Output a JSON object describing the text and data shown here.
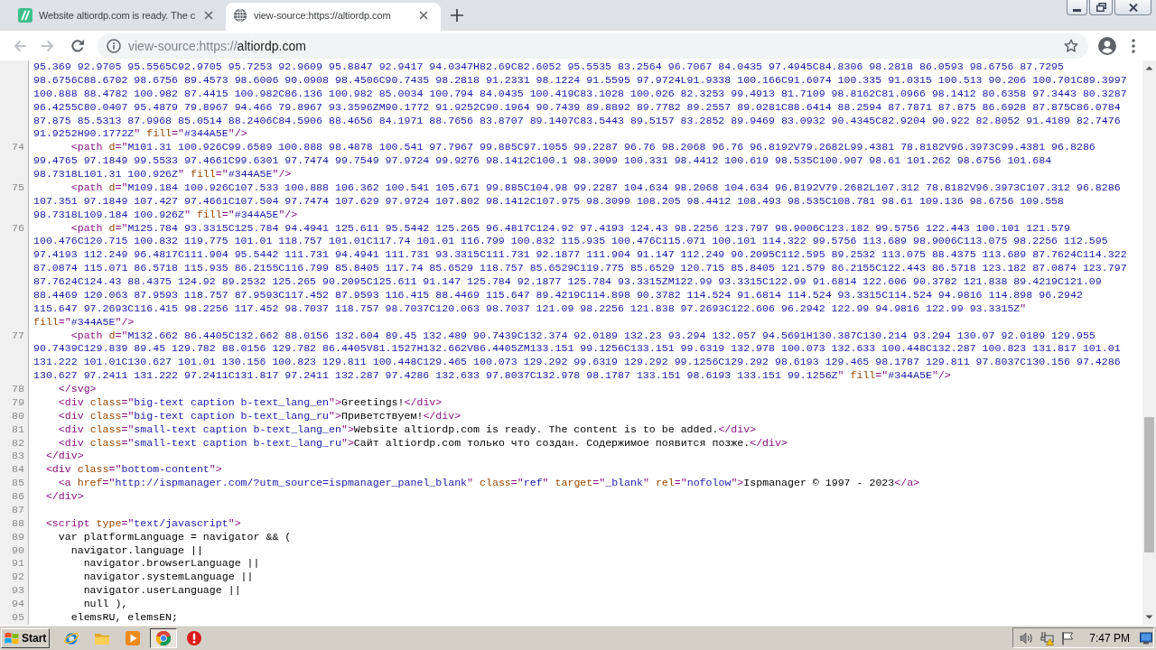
{
  "tabs": [
    {
      "title": "Website altiordp.com is ready. The c",
      "selected": false
    },
    {
      "title": "view-source:https://altiordp.com",
      "selected": true
    }
  ],
  "address_bar": {
    "prefix": "view-source:https://",
    "host": "altiordp.com"
  },
  "source_view": {
    "lines": [
      {
        "segments": [
          {
            "tokens": [
              {
                "kind": "value",
                "text": "95.369 92.9705 95.5565C92.9705 95.7253 92.9609 95.8847 92.9417 94.0347H82.69C82.6052 95.5535 83.2564 96.7067 84.0435 97.4945C84.8306 98.2818 86.0593 98.6756 87.7295"
              }
            ]
          },
          {
            "tokens": [
              {
                "kind": "value",
                "text": "98.6756C88.6702 98.6756 89.4573 98.6006 90.0908 98.4506C90.7435 98.2818 91.2331 98.1224 91.5595 97.9724L91.9338 100.166C91.6074 100.335 91.0315 100.513 90.206 100.701C89.3997"
              }
            ]
          },
          {
            "tokens": [
              {
                "kind": "value",
                "text": "100.888 88.4782 100.982 87.4415 100.982C86.136 100.982 85.0034 100.794 84.0435 100.419C83.1028 100.026 82.3253 99.4913 81.7109 98.8162C81.0966 98.1412 80.6358 97.3443 80.3287"
              }
            ]
          },
          {
            "tokens": [
              {
                "kind": "value",
                "text": "96.4255C80.0407 95.4879 79.8967 94.466 79.8967 93.3596ZM90.1772 91.9252C90.1964 90.7439 89.8892 89.7782 89.2557 89.0281C88.6414 88.2594 87.7871 87.875 86.6928 87.875C86.0784"
              }
            ]
          },
          {
            "tokens": [
              {
                "kind": "value",
                "text": "87.875 85.5313 87.9968 85.0514 88.2406C84.5906 88.4656 84.1971 88.7656 83.8707 89.1407C83.5443 89.5157 83.2852 89.9469 83.0932 90.4345C82.9204 90.922 82.8052 91.4189 82.7476"
              }
            ]
          },
          {
            "tokens": [
              {
                "kind": "value",
                "text": "91.9252H90.1772Z"
              },
              {
                "kind": "tag",
                "text": "\" "
              },
              {
                "kind": "attr",
                "text": "fill"
              },
              {
                "kind": "tag",
                "text": "=\""
              },
              {
                "kind": "value",
                "text": "#344A5E"
              },
              {
                "kind": "tag",
                "text": "\"/>"
              }
            ]
          }
        ]
      },
      {
        "number": "74",
        "segments": [
          {
            "tokens": [
              {
                "kind": "tag",
                "text": "      <path "
              },
              {
                "kind": "attr",
                "text": "d"
              },
              {
                "kind": "tag",
                "text": "=\""
              },
              {
                "kind": "value",
                "text": "M101.31 100.926C99.6589 100.888 98.4878 100.541 97.7967 99.885C97.1055 99.2287 96.76 98.2068 96.76 96.8192V79.2682L99.4381 78.8182V96.3973C99.4381 96.8286"
              }
            ]
          },
          {
            "tokens": [
              {
                "kind": "value",
                "text": "99.4765 97.1849 99.5533 97.4661C99.6301 97.7474 99.7549 97.9724 99.9276 98.1412C100.1 98.3099 100.331 98.4412 100.619 98.535C100.907 98.61 101.262 98.6756 101.684"
              }
            ]
          },
          {
            "tokens": [
              {
                "kind": "value",
                "text": "98.7318L101.31 100.926Z"
              },
              {
                "kind": "tag",
                "text": "\" "
              },
              {
                "kind": "attr",
                "text": "fill"
              },
              {
                "kind": "tag",
                "text": "=\""
              },
              {
                "kind": "value",
                "text": "#344A5E"
              },
              {
                "kind": "tag",
                "text": "\"/>"
              }
            ]
          }
        ]
      },
      {
        "number": "75",
        "segments": [
          {
            "tokens": [
              {
                "kind": "tag",
                "text": "      <path "
              },
              {
                "kind": "attr",
                "text": "d"
              },
              {
                "kind": "tag",
                "text": "=\""
              },
              {
                "kind": "value",
                "text": "M109.184 100.926C107.533 100.888 106.362 100.541 105.671 99.885C104.98 99.2287 104.634 98.2068 104.634 96.8192V79.2682L107.312 78.8182V96.3973C107.312 96.8286"
              }
            ]
          },
          {
            "tokens": [
              {
                "kind": "value",
                "text": "107.351 97.1849 107.427 97.4661C107.504 97.7474 107.629 97.9724 107.802 98.1412C107.975 98.3099 108.205 98.4412 108.493 98.535C108.781 98.61 109.136 98.6756 109.558"
              }
            ]
          },
          {
            "tokens": [
              {
                "kind": "value",
                "text": "98.7318L109.184 100.926Z"
              },
              {
                "kind": "tag",
                "text": "\" "
              },
              {
                "kind": "attr",
                "text": "fill"
              },
              {
                "kind": "tag",
                "text": "=\""
              },
              {
                "kind": "value",
                "text": "#344A5E"
              },
              {
                "kind": "tag",
                "text": "\"/>"
              }
            ]
          }
        ]
      },
      {
        "number": "76",
        "segments": [
          {
            "tokens": [
              {
                "kind": "tag",
                "text": "      <path "
              },
              {
                "kind": "attr",
                "text": "d"
              },
              {
                "kind": "tag",
                "text": "=\""
              },
              {
                "kind": "value",
                "text": "M125.784 93.3315C125.784 94.4941 125.611 95.5442 125.265 96.4817C124.92 97.4193 124.43 98.2256 123.797 98.9006C123.182 99.5756 122.443 100.101 121.579"
              }
            ]
          },
          {
            "tokens": [
              {
                "kind": "value",
                "text": "100.476C120.715 100.832 119.775 101.01 118.757 101.01C117.74 101.01 116.799 100.832 115.935 100.476C115.071 100.101 114.322 99.5756 113.689 98.9006C113.075 98.2256 112.595"
              }
            ]
          },
          {
            "tokens": [
              {
                "kind": "value",
                "text": "97.4193 112.249 96.4817C111.904 95.5442 111.731 94.4941 111.731 93.3315C111.731 92.1877 111.904 91.147 112.249 90.2095C112.595 89.2532 113.075 88.4375 113.689 87.7624C114.322"
              }
            ]
          },
          {
            "tokens": [
              {
                "kind": "value",
                "text": "87.0874 115.071 86.5718 115.935 86.2155C116.799 85.8405 117.74 85.6529 118.757 85.6529C119.775 85.6529 120.715 85.8405 121.579 86.2155C122.443 86.5718 123.182 87.0874 123.797"
              }
            ]
          },
          {
            "tokens": [
              {
                "kind": "value",
                "text": "87.7624C124.43 88.4375 124.92 89.2532 125.265 90.2095C125.611 91.147 125.784 92.1877 125.784 93.3315ZM122.99 93.3315C122.99 91.6814 122.606 90.3782 121.838 89.4219C121.09"
              }
            ]
          },
          {
            "tokens": [
              {
                "kind": "value",
                "text": "88.4469 120.063 87.9593 118.757 87.9593C117.452 87.9593 116.415 88.4469 115.647 89.4219C114.898 90.3782 114.524 91.6814 114.524 93.3315C114.524 94.9816 114.898 96.2942"
              }
            ]
          },
          {
            "tokens": [
              {
                "kind": "value",
                "text": "115.647 97.2693C116.415 98.2256 117.452 98.7037 118.757 98.7037C120.063 98.7037 121.09 98.2256 121.838 97.2693C122.606 96.2942 122.99 94.9816 122.99 93.3315Z"
              },
              {
                "kind": "tag",
                "text": "\""
              }
            ]
          },
          {
            "tokens": [
              {
                "kind": "attr",
                "text": "fill"
              },
              {
                "kind": "tag",
                "text": "=\""
              },
              {
                "kind": "value",
                "text": "#344A5E"
              },
              {
                "kind": "tag",
                "text": "\"/>"
              }
            ]
          }
        ]
      },
      {
        "number": "77",
        "segments": [
          {
            "tokens": [
              {
                "kind": "tag",
                "text": "      <path "
              },
              {
                "kind": "attr",
                "text": "d"
              },
              {
                "kind": "tag",
                "text": "=\""
              },
              {
                "kind": "value",
                "text": "M132.662 86.4405C132.662 88.0156 132.604 89.45 132.489 90.7439C132.374 92.0189 132.23 93.294 132.057 94.5691H130.387C130.214 93.294 130.07 92.0189 129.955"
              }
            ]
          },
          {
            "tokens": [
              {
                "kind": "value",
                "text": "90.7439C129.839 89.45 129.782 88.0156 129.782 86.4405V81.1527H132.662V86.4405ZM133.151 99.1256C133.151 99.6319 132.978 100.073 132.633 100.448C132.287 100.823 131.817 101.01"
              }
            ]
          },
          {
            "tokens": [
              {
                "kind": "value",
                "text": "131.222 101.01C130.627 101.01 130.156 100.823 129.811 100.448C129.465 100.073 129.292 99.6319 129.292 99.1256C129.292 98.6193 129.465 98.1787 129.811 97.8037C130.156 97.4286"
              }
            ]
          },
          {
            "tokens": [
              {
                "kind": "value",
                "text": "130.627 97.2411 131.222 97.2411C131.817 97.2411 132.287 97.4286 132.633 97.8037C132.978 98.1787 133.151 98.6193 133.151 99.1256Z"
              },
              {
                "kind": "tag",
                "text": "\" "
              },
              {
                "kind": "attr",
                "text": "fill"
              },
              {
                "kind": "tag",
                "text": "=\""
              },
              {
                "kind": "value",
                "text": "#344A5E"
              },
              {
                "kind": "tag",
                "text": "\"/>"
              }
            ]
          }
        ]
      },
      {
        "number": "78",
        "segments": [
          {
            "tokens": [
              {
                "kind": "tag",
                "text": "    </svg>"
              }
            ]
          }
        ]
      },
      {
        "number": "79",
        "segments": [
          {
            "tokens": [
              {
                "kind": "tag",
                "text": "    <div "
              },
              {
                "kind": "attr",
                "text": "class"
              },
              {
                "kind": "tag",
                "text": "=\""
              },
              {
                "kind": "value",
                "text": "big-text caption b-text_lang_en"
              },
              {
                "kind": "tag",
                "text": "\">"
              },
              {
                "kind": "text",
                "text": "Greetings!"
              },
              {
                "kind": "tag",
                "text": "</div>"
              }
            ]
          }
        ]
      },
      {
        "number": "80",
        "segments": [
          {
            "tokens": [
              {
                "kind": "tag",
                "text": "    <div "
              },
              {
                "kind": "attr",
                "text": "class"
              },
              {
                "kind": "tag",
                "text": "=\""
              },
              {
                "kind": "value",
                "text": "big-text caption b-text_lang_ru"
              },
              {
                "kind": "tag",
                "text": "\">"
              },
              {
                "kind": "text",
                "text": "Приветствуем!"
              },
              {
                "kind": "tag",
                "text": "</div>"
              }
            ]
          }
        ]
      },
      {
        "number": "81",
        "segments": [
          {
            "tokens": [
              {
                "kind": "tag",
                "text": "    <div "
              },
              {
                "kind": "attr",
                "text": "class"
              },
              {
                "kind": "tag",
                "text": "=\""
              },
              {
                "kind": "value",
                "text": "small-text caption b-text_lang_en"
              },
              {
                "kind": "tag",
                "text": "\">"
              },
              {
                "kind": "text",
                "text": "Website altiordp.com is ready. The content is to be added."
              },
              {
                "kind": "tag",
                "text": "</div>"
              }
            ]
          }
        ]
      },
      {
        "number": "82",
        "segments": [
          {
            "tokens": [
              {
                "kind": "tag",
                "text": "    <div "
              },
              {
                "kind": "attr",
                "text": "class"
              },
              {
                "kind": "tag",
                "text": "=\""
              },
              {
                "kind": "value",
                "text": "small-text caption b-text_lang_ru"
              },
              {
                "kind": "tag",
                "text": "\">"
              },
              {
                "kind": "text",
                "text": "Сайт altiordp.com только что создан. Содержимое появится позже."
              },
              {
                "kind": "tag",
                "text": "</div>"
              }
            ]
          }
        ]
      },
      {
        "number": "83",
        "segments": [
          {
            "tokens": [
              {
                "kind": "tag",
                "text": "  </div>"
              }
            ]
          }
        ]
      },
      {
        "number": "84",
        "segments": [
          {
            "tokens": [
              {
                "kind": "tag",
                "text": "  <div "
              },
              {
                "kind": "attr",
                "text": "class"
              },
              {
                "kind": "tag",
                "text": "=\""
              },
              {
                "kind": "value",
                "text": "bottom-content"
              },
              {
                "kind": "tag",
                "text": "\">"
              }
            ]
          }
        ]
      },
      {
        "number": "85",
        "segments": [
          {
            "tokens": [
              {
                "kind": "tag",
                "text": "    <a "
              },
              {
                "kind": "attr",
                "text": "href"
              },
              {
                "kind": "tag",
                "text": "=\""
              },
              {
                "kind": "value",
                "text": "http://ispmanager.com/?utm_source=ispmanager_panel_blank"
              },
              {
                "kind": "tag",
                "text": "\" "
              },
              {
                "kind": "attr",
                "text": "class"
              },
              {
                "kind": "tag",
                "text": "=\""
              },
              {
                "kind": "value",
                "text": "ref"
              },
              {
                "kind": "tag",
                "text": "\" "
              },
              {
                "kind": "attr",
                "text": "target"
              },
              {
                "kind": "tag",
                "text": "=\""
              },
              {
                "kind": "value",
                "text": "_blank"
              },
              {
                "kind": "tag",
                "text": "\" "
              },
              {
                "kind": "attr",
                "text": "rel"
              },
              {
                "kind": "tag",
                "text": "=\""
              },
              {
                "kind": "value",
                "text": "nofolow"
              },
              {
                "kind": "tag",
                "text": "\">"
              },
              {
                "kind": "text",
                "text": "Ispmanager © 1997 - 2023"
              },
              {
                "kind": "tag",
                "text": "</a>"
              }
            ]
          }
        ]
      },
      {
        "number": "86",
        "segments": [
          {
            "tokens": [
              {
                "kind": "tag",
                "text": "  </div>"
              }
            ]
          }
        ]
      },
      {
        "number": "87"
      },
      {
        "number": "88",
        "segments": [
          {
            "tokens": [
              {
                "kind": "tag",
                "text": "  <script "
              },
              {
                "kind": "attr",
                "text": "type"
              },
              {
                "kind": "tag",
                "text": "=\""
              },
              {
                "kind": "value",
                "text": "text/javascript"
              },
              {
                "kind": "tag",
                "text": "\">"
              }
            ]
          }
        ]
      },
      {
        "number": "89",
        "segments": [
          {
            "tokens": [
              {
                "kind": "text",
                "text": "    var platformLanguage = navigator && ("
              }
            ]
          }
        ]
      },
      {
        "number": "90",
        "segments": [
          {
            "tokens": [
              {
                "kind": "text",
                "text": "      navigator.language ||"
              }
            ]
          }
        ]
      },
      {
        "number": "91",
        "segments": [
          {
            "tokens": [
              {
                "kind": "text",
                "text": "        navigator.browserLanguage ||"
              }
            ]
          }
        ]
      },
      {
        "number": "92",
        "segments": [
          {
            "tokens": [
              {
                "kind": "text",
                "text": "        navigator.systemLanguage ||"
              }
            ]
          }
        ]
      },
      {
        "number": "93",
        "segments": [
          {
            "tokens": [
              {
                "kind": "text",
                "text": "        navigator.userLanguage ||"
              }
            ]
          }
        ]
      },
      {
        "number": "94",
        "segments": [
          {
            "tokens": [
              {
                "kind": "text",
                "text": "        null ),"
              }
            ]
          }
        ]
      },
      {
        "number": "95",
        "segments": [
          {
            "tokens": [
              {
                "kind": "text",
                "text": "      elemsRU, elemsEN;"
              }
            ]
          }
        ]
      }
    ]
  },
  "taskbar": {
    "start": "Start",
    "apps": [
      {
        "selected": false
      },
      {
        "selected": false
      },
      {
        "selected": false
      },
      {
        "selected": true
      },
      {
        "selected": false
      }
    ],
    "clock": "7:47 PM"
  }
}
